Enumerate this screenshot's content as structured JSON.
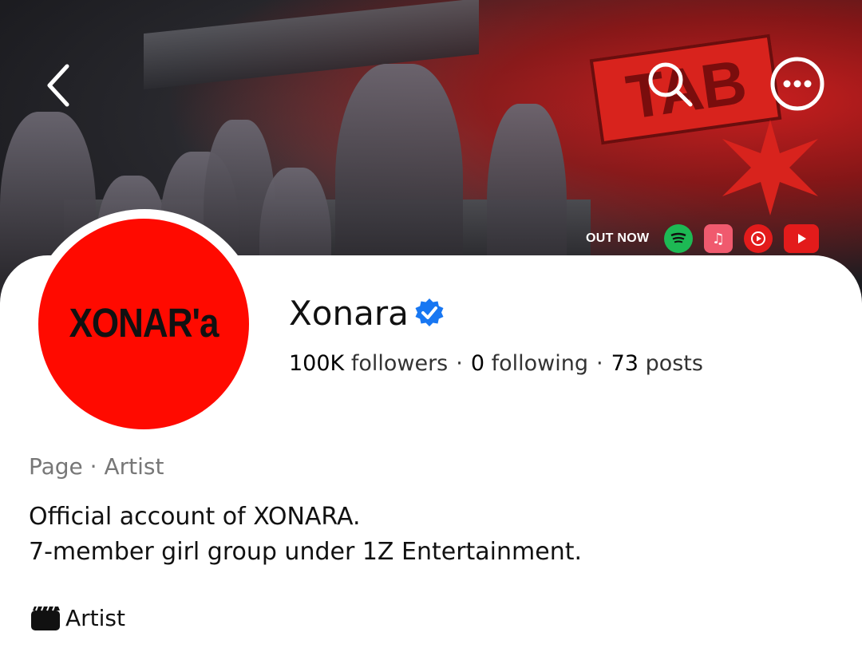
{
  "cover": {
    "logo_text": "TAB",
    "out_now_label": "OUT NOW",
    "stream_icons": [
      "spotify-icon",
      "apple-music-icon",
      "youtube-music-icon",
      "youtube-icon"
    ]
  },
  "nav": {
    "back_icon": "chevron-left-icon",
    "search_icon": "search-icon",
    "more_icon": "more-options-icon"
  },
  "profile": {
    "avatar_text": "XONAR'a",
    "name": "Xonara",
    "verified_icon": "verified-badge-icon",
    "stats": {
      "followers_count": "100K",
      "followers_label": "followers",
      "following_count": "0",
      "following_label": "following",
      "posts_count": "73",
      "posts_label": "posts",
      "separator": "·"
    },
    "category": "Page · Artist",
    "bio_lines": [
      "Official account of XONARA.",
      "7-member girl group under 1Z Entertainment."
    ],
    "tag": {
      "icon": "clapperboard-icon",
      "label": "Artist"
    }
  },
  "colors": {
    "avatar_bg": "#ff0a00",
    "verified": "#1877f2",
    "spotify": "#1DB954"
  }
}
